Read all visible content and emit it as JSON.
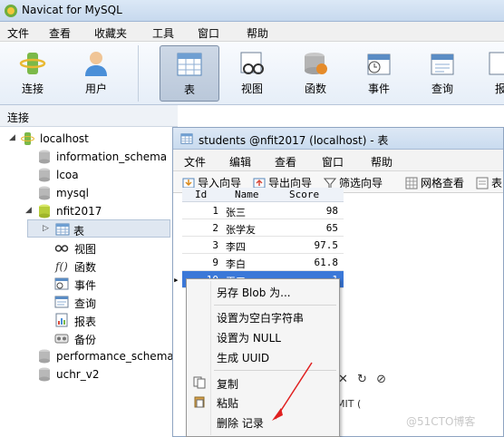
{
  "window": {
    "title": "Navicat for MySQL"
  },
  "menu": {
    "items": [
      "文件",
      "查看",
      "收藏夹",
      "工具",
      "窗口",
      "帮助"
    ]
  },
  "toolbar": {
    "buttons": [
      {
        "label": "连接",
        "icon": "connection-icon"
      },
      {
        "label": "用户",
        "icon": "user-icon"
      },
      {
        "label": "表",
        "icon": "table-icon"
      },
      {
        "label": "视图",
        "icon": "view-icon"
      },
      {
        "label": "函数",
        "icon": "function-icon"
      },
      {
        "label": "事件",
        "icon": "event-icon"
      },
      {
        "label": "查询",
        "icon": "query-icon"
      },
      {
        "label": "报",
        "icon": "report-icon"
      }
    ]
  },
  "connections": {
    "header": "连接",
    "tree": [
      {
        "label": "localhost"
      },
      {
        "label": "information_schema"
      },
      {
        "label": "lcoa"
      },
      {
        "label": "mysql"
      },
      {
        "label": "nfit2017"
      },
      {
        "label": "表"
      },
      {
        "label": "视图"
      },
      {
        "label": "函数"
      },
      {
        "label": "事件"
      },
      {
        "label": "查询"
      },
      {
        "label": "报表"
      },
      {
        "label": "备份"
      },
      {
        "label": "performance_schema"
      },
      {
        "label": "uchr_v2"
      }
    ]
  },
  "table_window": {
    "title": "students @nfit2017 (localhost) - 表",
    "menu": [
      "文件",
      "编辑",
      "查看",
      "窗口",
      "帮助"
    ],
    "tools": [
      "导入向导",
      "导出向导",
      "筛选向导",
      "网格查看",
      "表"
    ],
    "columns": [
      "Id",
      "Name",
      "Score"
    ],
    "rows": [
      {
        "id": "1",
        "name": "张三",
        "score": "98"
      },
      {
        "id": "2",
        "name": "张学友",
        "score": "65"
      },
      {
        "id": "3",
        "name": "李四",
        "score": "97.5"
      },
      {
        "id": "9",
        "name": "李白",
        "score": "61.8"
      },
      {
        "id": "10",
        "name": "王五",
        "score": "1"
      }
    ],
    "status": "MIT ("
  },
  "context_menu": {
    "items": [
      "另存 Blob 为...",
      "设置为空白字符串",
      "设置为 NULL",
      "生成 UUID",
      "复制",
      "粘贴",
      "删除 记录"
    ]
  },
  "watermark": "@51CTO博客"
}
